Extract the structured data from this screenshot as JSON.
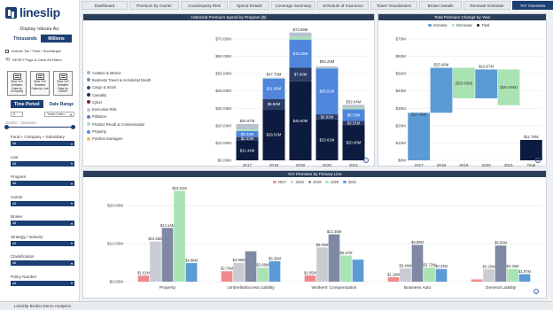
{
  "app": {
    "logo_text": "lineslip",
    "status_text": "LineSlip Broker Demo Analytics"
  },
  "sidebar": {
    "display_values_label": "Display Values As:",
    "toggle": [
      "Thousands",
      "Millions"
    ],
    "checkboxes": [
      "Include Tax / Fees / Surcharges",
      "RESET Page & Clear All Filters"
    ],
    "view_buttons": [
      "View YoY Detailed Data by Company",
      "View YoY Detailed Data by Line",
      "View YoY Detailed Data by Carrier"
    ],
    "period_buttons": [
      "Time Period",
      "Date Range"
    ],
    "period_select": "5",
    "unit_select": "Years-Calen...",
    "date_range": "1/1/2017 - 12/31/2021",
    "filters": [
      {
        "label": "Fund + Company + Subsidiary",
        "value": "All"
      },
      {
        "label": "Line",
        "value": "All"
      },
      {
        "label": "Program",
        "value": "All"
      },
      {
        "label": "Carrier",
        "value": "All"
      },
      {
        "label": "Broker",
        "value": "All"
      },
      {
        "label": "Strategy / Industry",
        "value": "All"
      },
      {
        "label": "Classification",
        "value": "All"
      },
      {
        "label": "Policy Number",
        "value": "All"
      }
    ],
    "extra_selects": [
      "All"
    ]
  },
  "tabs": [
    "Dashboard",
    "Premium by Carrier",
    "Counterparty Risk",
    "Spend Details",
    "Coverage Summary",
    "Schedule of Insurance",
    "Tower Visualization",
    "Broker Details",
    "Renewal Schedule",
    "YoY Overview"
  ],
  "active_tab": "YoY Overview",
  "colors": {
    "navy": "#1c3f73",
    "increase": "#5b9bd5",
    "decrease": "#a9e3b4",
    "total": "#0d1b40"
  },
  "panels": {
    "spend_title": "Historical Premium Spend by Program ($)",
    "change_title": "Total Premium Change by Year",
    "yoy_title": "YoY Premium by Primary Line"
  },
  "chart_data": [
    {
      "type": "bar",
      "stacked": true,
      "title": "Historical Premium Spend by Program ($)",
      "categories": [
        "2017",
        "2018",
        "2019",
        "2020",
        "2021"
      ],
      "ylim": [
        0,
        70
      ],
      "yticks": [
        "$0.00M",
        "$10.00M",
        "$20.00M",
        "$30.00M",
        "$40.00M",
        "$50.00M",
        "$60.00M",
        "$70.00M"
      ],
      "legend_items": [
        {
          "name": "Aviation & Marine",
          "color": "#a9b4c2"
        },
        {
          "name": "Business Travel & Accidental Death",
          "color": "#7d8fa8"
        },
        {
          "name": "Cargo & Stock",
          "color": "#3a4f73"
        },
        {
          "name": "Casualty",
          "color": "#1c2f56"
        },
        {
          "name": "Cyber",
          "color": "#8a1a3a"
        },
        {
          "name": "Executive Risk",
          "color": "#b7c4d4"
        },
        {
          "name": "Pollution",
          "color": "#5b7ec4"
        },
        {
          "name": "Product Recall & Contamination",
          "color": "#a9e3b4"
        },
        {
          "name": "Property",
          "color": "#4f8fe0"
        },
        {
          "name": "Punitive Damages",
          "color": "#e6c25a"
        }
      ],
      "series": [
        {
          "name": "Executive Risk",
          "color": "#0d1b40",
          "values": [
            11.44,
            29.52,
            45.6,
            23.61,
            20.4
          ],
          "labels": [
            "$11.44M",
            "$29.52M",
            "$45.60M",
            "$23.61M",
            "$20.40M"
          ]
        },
        {
          "name": "Casualty",
          "color": "#2a3b66",
          "values": [
            2.02,
            5.9,
            7.9,
            2.92,
            2.31
          ],
          "labels": [
            "$2.02M",
            "$5.90M",
            "$7.90M",
            "$2.92M",
            "$2.31M"
          ]
        },
        {
          "name": "Property",
          "color": "#4f86dc",
          "values": [
            3.42,
            11.69,
            16.16,
            26.51,
            6.76
          ],
          "labels": [
            "$3.42M",
            "$11.69M",
            "$16.16M",
            "$26.51M",
            "$6.76M"
          ]
        },
        {
          "name": "Product Recall & Contamination",
          "color": "#a9e3b4",
          "values": [
            0.9,
            0.2,
            1.5,
            0.1,
            0.8
          ]
        },
        {
          "name": "Aviation & Marine",
          "color": "#b8c3cf",
          "values": [
            3.19,
            0.37,
            2.58,
            0.96,
            1.77
          ]
        }
      ],
      "totals": [
        20.97,
        47.68,
        73.69,
        55.2,
        32.04
      ],
      "total_labels": [
        "$20.97M",
        "$47.75M",
        "$73.69M",
        "$55.20M",
        "$32.04M"
      ]
    },
    {
      "type": "bar",
      "waterfall": true,
      "title": "Total Premium Change by Year",
      "legend": [
        "Increase",
        "Decrease",
        "Total"
      ],
      "categories": [
        "2017",
        "2018",
        "2019",
        "2020",
        "2021",
        "Total"
      ],
      "ylim": [
        0,
        70
      ],
      "steps": [
        {
          "kind": "increase",
          "start": 0,
          "end": 27.42,
          "label": "$27.42M"
        },
        {
          "kind": "increase",
          "start": 27.42,
          "end": 53.38,
          "label": "$25.96M"
        },
        {
          "kind": "decrease",
          "start": 53.38,
          "end": 35.75,
          "label": "($20.63M)"
        },
        {
          "kind": "increase",
          "start": 35.75,
          "end": 52.42,
          "label": "$16.67M"
        },
        {
          "kind": "decrease",
          "start": 52.42,
          "end": 31.76,
          "label": "($20.66M)"
        },
        {
          "kind": "total",
          "start": 0,
          "end": 11.76,
          "label": "$11.76M"
        }
      ]
    },
    {
      "type": "bar",
      "title": "YoY Premium by Primary Line",
      "categories": [
        "Property",
        "Umbrella/Excess Liability",
        "Workers' Compensation",
        "Business Auto",
        "General Liability"
      ],
      "ylim": [
        0,
        20
      ],
      "yticks": [
        "$0.00M",
        "$10.00M",
        "$20.00M"
      ],
      "series": [
        {
          "name": "2017",
          "color": "#f08a8a",
          "values": [
            1.61,
            2.74,
            1.65,
            1.16,
            0.6
          ]
        },
        {
          "name": "2018",
          "color": "#c9ccd3",
          "values": [
            10.55,
            4.96,
            9.0,
            3.48,
            3.25
          ]
        },
        {
          "name": "2019",
          "color": "#8089a3",
          "values": [
            14.14,
            8.0,
            12.45,
            9.68,
            9.5
          ]
        },
        {
          "name": "2020",
          "color": "#a9e3b4",
          "values": [
            23.91,
            3.68,
            6.87,
            3.72,
            3.33
          ]
        },
        {
          "name": "2021",
          "color": "#5b9bd5",
          "values": [
            4.88,
            5.35,
            5.8,
            3.33,
            1.97
          ]
        }
      ],
      "labels": [
        [
          "$1.61M",
          "$10.55M",
          "$14.14M",
          "$23.91M",
          "$4.88M"
        ],
        [
          "$2.74M",
          "$4.96M",
          "",
          "$3.68M",
          "$5.35M"
        ],
        [
          "$1.65M",
          "$9.00M",
          "$12.45M",
          "$6.87M",
          ""
        ],
        [
          "$1.16M",
          "$3.48M",
          "$9.68M",
          "$3.72M",
          "$3.33M"
        ],
        [
          "",
          "$3.25M",
          "$9.50M",
          "$3.33M",
          "$1.97M"
        ]
      ]
    }
  ]
}
